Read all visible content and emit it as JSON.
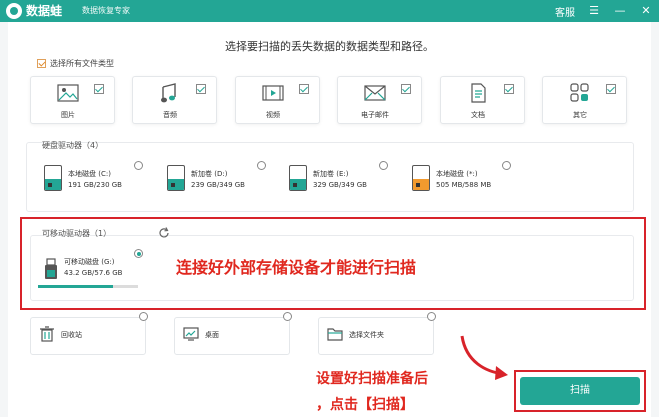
{
  "titlebar": {
    "app_name": "数据蛙",
    "app_subtitle": "数据恢复专家",
    "service": "客服",
    "menu_icon": "☰",
    "minimize_icon": "—",
    "close_icon": "✕"
  },
  "main": {
    "headline": "选择要扫描的丢失数据的数据类型和路径。",
    "select_all": "选择所有文件类型",
    "file_types": [
      {
        "label": "图片",
        "icon": "image-icon"
      },
      {
        "label": "音频",
        "icon": "audio-icon"
      },
      {
        "label": "视频",
        "icon": "video-icon"
      },
      {
        "label": "电子邮件",
        "icon": "email-icon"
      },
      {
        "label": "文档",
        "icon": "document-icon"
      },
      {
        "label": "其它",
        "icon": "other-icon"
      }
    ]
  },
  "hard_drives": {
    "title": "硬盘驱动器（4）",
    "drives": [
      {
        "name": "本地磁盘 (C:)",
        "size": "191 GB/230 GB",
        "usage": 0.83,
        "color": "#23a695"
      },
      {
        "name": "新加卷 (D:)",
        "size": "239 GB/349 GB",
        "usage": 0.68,
        "color": "#23a695"
      },
      {
        "name": "新加卷 (E:)",
        "size": "329 GB/349 GB",
        "usage": 0.94,
        "color": "#23a695"
      },
      {
        "name": "本地磁盘 (*:)",
        "size": "505 MB/588 MB",
        "usage": 0.86,
        "color": "#f29a2e"
      }
    ]
  },
  "removable": {
    "title": "可移动驱动器（1）",
    "drive_name": "可移动磁盘 (G:)",
    "drive_size": "43.2 GB/57.6 GB",
    "usage": 0.75,
    "annotation": "连接好外部存储设备才能进行扫描"
  },
  "locations": [
    {
      "label": "回收站",
      "icon": "recycle-bin-icon"
    },
    {
      "label": "桌面",
      "icon": "desktop-icon"
    },
    {
      "label": "选择文件夹",
      "icon": "folder-icon"
    }
  ],
  "bottom": {
    "annotation_line1": "设置好扫描准备后",
    "annotation_line2": "，点击【扫描】",
    "scan_button": "扫描"
  },
  "colors": {
    "accent": "#23a695",
    "annotation_red": "#d8232a",
    "orange": "#f29a2e"
  }
}
